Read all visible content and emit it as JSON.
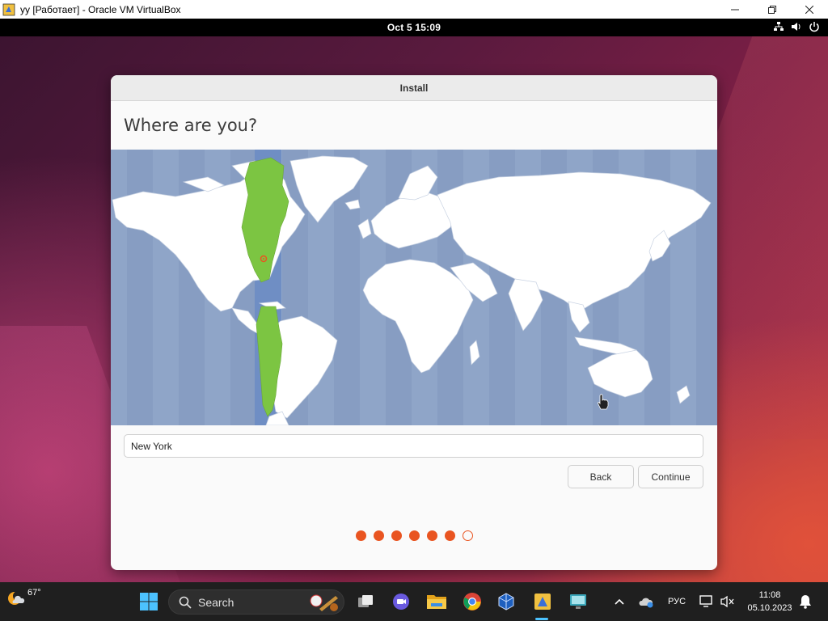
{
  "host_window": {
    "title": "yy [Работает] - Oracle VM VirtualBox",
    "icon": "virtualbox-icon",
    "controls": [
      "minimize-icon",
      "maximize-icon",
      "close-icon"
    ]
  },
  "guest_topbar": {
    "clock": "Oct 5  15:09",
    "tray_icons": [
      "network-icon",
      "volume-icon",
      "power-icon"
    ]
  },
  "installer": {
    "window_title": "Install",
    "heading": "Where are you?",
    "map": {
      "selected_timezone_color": "#7cc542",
      "ocean_color": "#8fa5c8",
      "land_color": "#ffffff",
      "selected_city_marker": "location-pin-icon"
    },
    "location_input": {
      "value": "New York"
    },
    "back_label": "Back",
    "continue_label": "Continue",
    "progress": {
      "total_steps": 7,
      "completed_steps": 6,
      "accent_color": "#e95420"
    }
  },
  "taskbar": {
    "weather": {
      "temp": "67°",
      "icon": "weather-moon-cloud-icon"
    },
    "search_label": "Search",
    "pinned_apps": [
      "start-icon",
      "task-view-icon",
      "chat-icon",
      "file-explorer-icon",
      "chrome-icon",
      "virtualbox-app-icon",
      "vm-window-icon",
      "remote-desktop-icon"
    ],
    "tray": {
      "language": "РУС",
      "time": "11:08",
      "date": "05.10.2023"
    }
  }
}
